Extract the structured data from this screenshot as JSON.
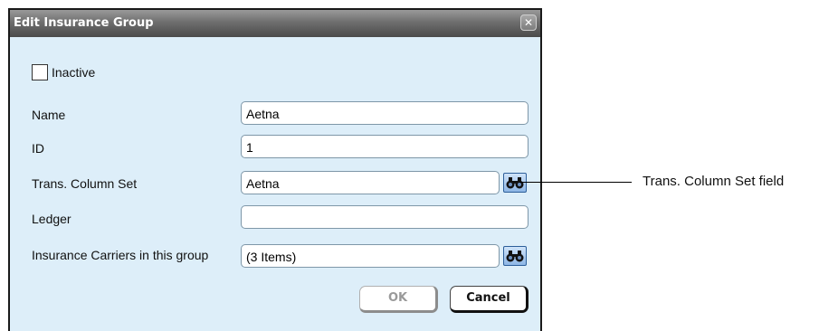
{
  "dialog": {
    "title": "Edit Insurance Group",
    "close_glyph": "✕",
    "inactive_label": "Inactive",
    "inactive_checked": false,
    "fields": {
      "name_label": "Name",
      "name_value": "Aetna",
      "id_label": "ID",
      "id_value": "1",
      "trans_label": "Trans. Column Set",
      "trans_value": "Aetna",
      "ledger_label": "Ledger",
      "ledger_value": "",
      "carriers_label": "Insurance Carriers in this group",
      "carriers_value": "(3 Items)"
    },
    "buttons": {
      "ok": "OK",
      "cancel": "Cancel"
    },
    "icons": {
      "trans_lookup": "binoculars-icon",
      "carriers_lookup": "binoculars-icon",
      "close": "close-icon"
    }
  },
  "callout": {
    "text": "Trans. Column Set field"
  }
}
